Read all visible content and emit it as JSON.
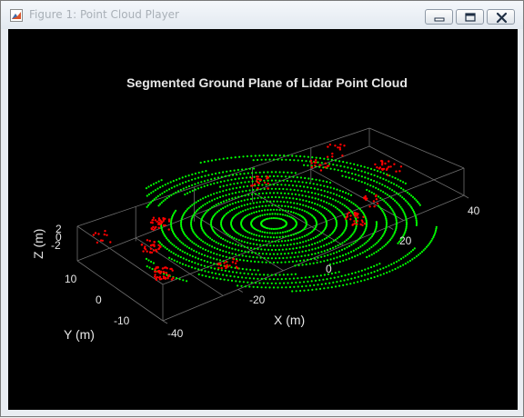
{
  "window": {
    "title": "Figure 1: Point Cloud Player",
    "icon": "matlab-figure-icon",
    "controls": [
      "minimize-icon",
      "maximize-icon",
      "close-icon"
    ]
  },
  "plot": {
    "title": "Segmented Ground Plane of Lidar Point Cloud",
    "x_label": "X (m)",
    "y_label": "Y (m)",
    "z_label": "Z (m)",
    "x_ticks": [
      "-40",
      "-20",
      "0",
      "20",
      "40"
    ],
    "y_ticks": [
      "10",
      "0",
      "-10"
    ],
    "z_ticks": [
      "2",
      "0",
      "-2"
    ],
    "colors": {
      "background": "#000000",
      "ground": "#00ff00",
      "obstacle": "#ff0000",
      "text": "#e6e6e6"
    }
  }
}
